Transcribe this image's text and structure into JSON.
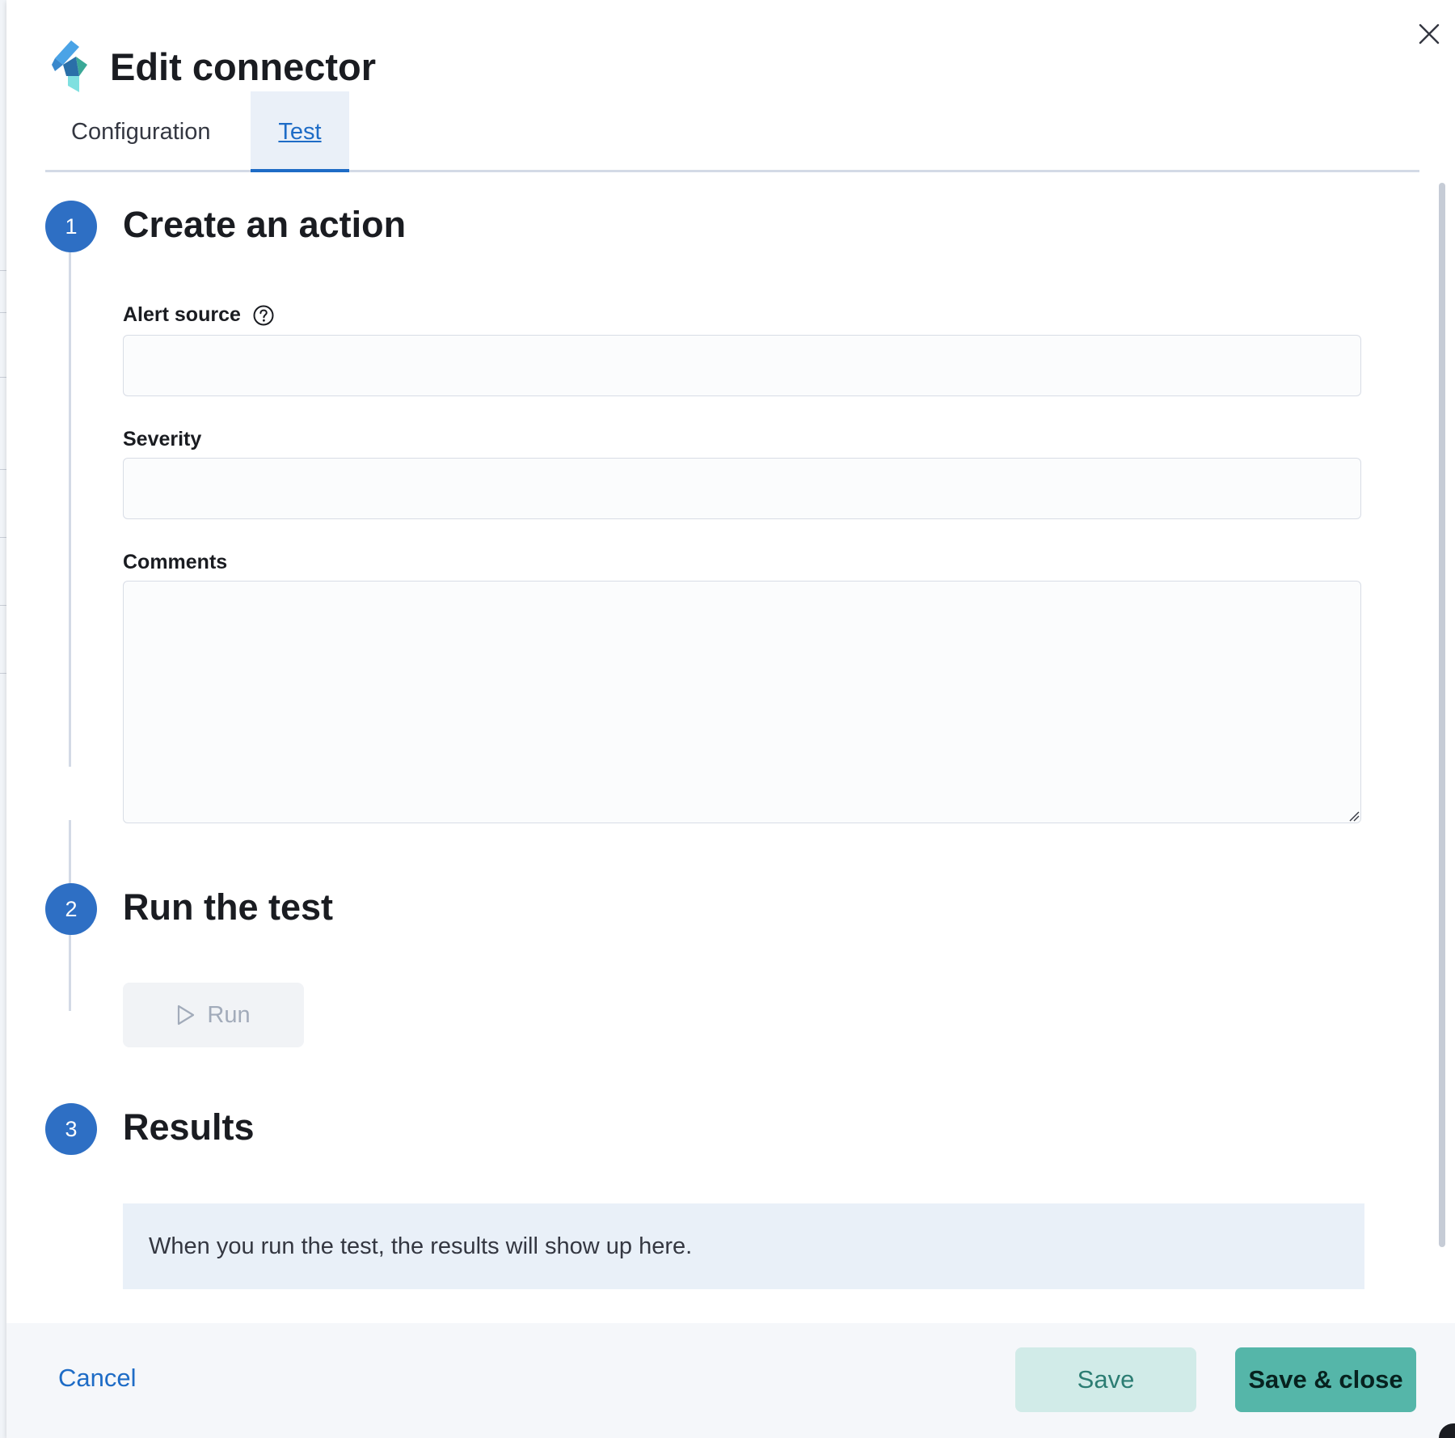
{
  "flyout": {
    "title": "Edit connector",
    "tabs": [
      {
        "label": "Configuration",
        "selected": false
      },
      {
        "label": "Test",
        "selected": true
      }
    ]
  },
  "steps": [
    {
      "number": "1",
      "title": "Create an action"
    },
    {
      "number": "2",
      "title": "Run the test"
    },
    {
      "number": "3",
      "title": "Results"
    }
  ],
  "form": {
    "alert_source": {
      "label": "Alert source",
      "value": ""
    },
    "severity": {
      "label": "Severity",
      "value": ""
    },
    "comments": {
      "label": "Comments",
      "value": ""
    }
  },
  "run": {
    "label": "Run",
    "disabled": true
  },
  "results": {
    "message": "When you run the test, the results will show up here."
  },
  "footer": {
    "cancel_label": "Cancel",
    "save_label": "Save",
    "save_close_label": "Save & close"
  },
  "colors": {
    "primary": "#2e6fc4",
    "link": "#1e6cc6",
    "success": "#55b6a9",
    "success_light": "#d1ebe8"
  },
  "icons": {
    "close": "close-icon",
    "logo": "connector-logo",
    "help": "question-circle-icon",
    "run": "play-icon"
  }
}
